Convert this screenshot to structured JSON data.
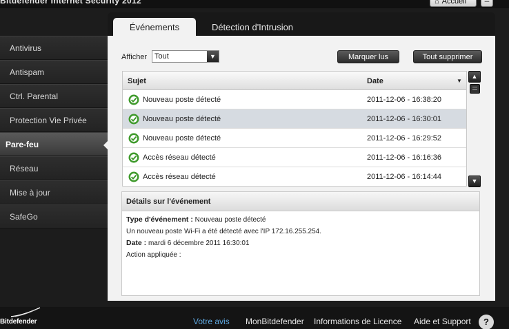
{
  "window": {
    "title": "Bitdefender Internet Security 2012",
    "home_label": "Accueil",
    "minimize_label": "–"
  },
  "sidebar": {
    "items": [
      {
        "label": "Antivirus"
      },
      {
        "label": "Antispam"
      },
      {
        "label": "Ctrl. Parental"
      },
      {
        "label": "Protection Vie Privée"
      },
      {
        "label": "Pare-feu",
        "active": true
      },
      {
        "label": "Réseau"
      },
      {
        "label": "Mise à jour"
      },
      {
        "label": "SafeGo"
      }
    ]
  },
  "tabs": [
    {
      "label": "Événements",
      "active": true
    },
    {
      "label": "Détection d'Intrusion"
    }
  ],
  "toolbar": {
    "filter_label": "Afficher",
    "filter_value": "Tout",
    "mark_read_label": "Marquer lus",
    "delete_all_label": "Tout supprimer"
  },
  "table": {
    "columns": [
      "Sujet",
      "Date"
    ],
    "rows": [
      {
        "subject": "Nouveau poste détecté",
        "date": "2011-12-06 - 16:38:20"
      },
      {
        "subject": "Nouveau poste détecté",
        "date": "2011-12-06 - 16:30:01",
        "selected": true
      },
      {
        "subject": "Nouveau poste détecté",
        "date": "2011-12-06 - 16:29:52"
      },
      {
        "subject": "Accès réseau détecté",
        "date": "2011-12-06 - 16:16:36"
      },
      {
        "subject": "Accès réseau détecté",
        "date": "2011-12-06 - 16:14:44"
      }
    ]
  },
  "details": {
    "title": "Détails sur l'événement",
    "type_label": "Type d'événement :",
    "type_value": "Nouveau poste détecté",
    "description": "Un nouveau poste Wi-Fi a été détecté avec l'IP 172.16.255.254.",
    "date_label": "Date :",
    "date_value": "mardi 6 décembre 2011 16:30:01",
    "action_label": "Action appliquée :"
  },
  "footer": {
    "brand": "Bitdefender",
    "links": [
      "Votre avis",
      "MonBitdefender",
      "Informations de Licence",
      "Aide et Support"
    ],
    "help_label": "?"
  },
  "colors": {
    "accent_link": "#5fa8e0",
    "event_icon_green": "#3f9a2c",
    "selected_row": "#d6dbe1"
  }
}
